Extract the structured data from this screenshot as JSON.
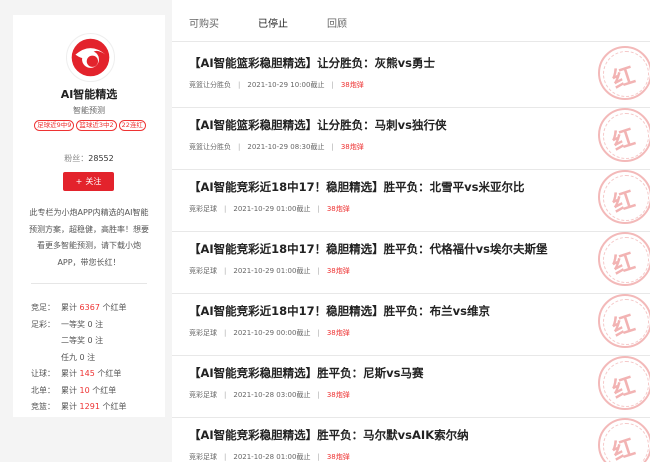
{
  "sidebar": {
    "name": "AI智能精选",
    "subtitle": "智能预测",
    "tags": [
      "足球近9中9",
      "篮球近3中2",
      "22连红"
    ],
    "fans_label": "粉丝：",
    "fans_count": "28552",
    "follow_label": "关注",
    "description": "此专栏为小炮APP内精选的AI智能预测方案，超稳健，高胜率！想要看更多智能预测，请下载小炮APP，带您长红！",
    "stats": [
      {
        "label": "竞足：",
        "prefix": "累计 ",
        "num": "6367",
        "suffix": " 个红单"
      },
      {
        "label": "足彩：",
        "prefix": "一等奖 0 注",
        "num": "",
        "suffix": ""
      },
      {
        "label": "",
        "prefix": "二等奖 0 注",
        "num": "",
        "suffix": ""
      },
      {
        "label": "",
        "prefix": "任九 0 注",
        "num": "",
        "suffix": ""
      },
      {
        "label": "让球：",
        "prefix": "累计 ",
        "num": "145",
        "suffix": " 个红单"
      },
      {
        "label": "北单：",
        "prefix": "累计 ",
        "num": "10",
        "suffix": " 个红单"
      },
      {
        "label": "竞篮：",
        "prefix": "累计 ",
        "num": "1291",
        "suffix": " 个红单"
      }
    ]
  },
  "tabs": [
    "可购买",
    "已停止",
    "回顾"
  ],
  "active_tab": "已停止",
  "stamp_text": "红",
  "items": [
    {
      "title": "【AI智能篮彩稳胆精选】让分胜负：灰熊vs勇士",
      "category": "竞篮让分胜负",
      "time": "2021-10-29 10:00截止",
      "price": "38炮弹"
    },
    {
      "title": "【AI智能篮彩稳胆精选】让分胜负：马刺vs独行侠",
      "category": "竞篮让分胜负",
      "time": "2021-10-29 08:30截止",
      "price": "38炮弹"
    },
    {
      "title": "【AI智能竞彩近18中17！稳胆精选】胜平负：北雪平vs米亚尔比",
      "category": "竞彩足球",
      "time": "2021-10-29 01:00截止",
      "price": "38炮弹"
    },
    {
      "title": "【AI智能竞彩近18中17！稳胆精选】胜平负：代格福什vs埃尔夫斯堡",
      "category": "竞彩足球",
      "time": "2021-10-29 01:00截止",
      "price": "38炮弹"
    },
    {
      "title": "【AI智能竞彩近18中17！稳胆精选】胜平负：布兰vs维京",
      "category": "竞彩足球",
      "time": "2021-10-29 00:00截止",
      "price": "38炮弹"
    },
    {
      "title": "【AI智能竞彩稳胆精选】胜平负：尼斯vs马赛",
      "category": "竞彩足球",
      "time": "2021-10-28 03:00截止",
      "price": "38炮弹"
    },
    {
      "title": "【AI智能竞彩稳胆精选】胜平负：马尔默vsAIK索尔纳",
      "category": "竞彩足球",
      "time": "2021-10-28 01:00截止",
      "price": "38炮弹"
    }
  ]
}
